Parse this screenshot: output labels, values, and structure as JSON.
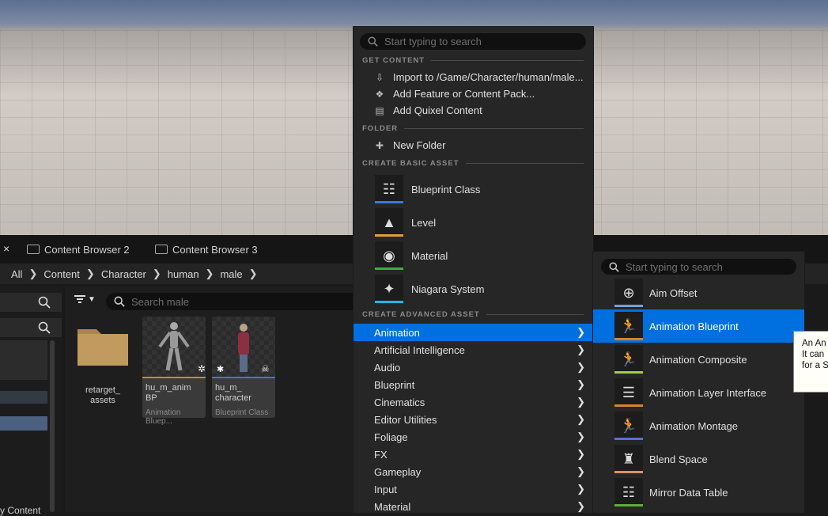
{
  "content_browser": {
    "close_glyph": "×",
    "tabs": [
      "Content Browser 2",
      "Content Browser 3"
    ],
    "breadcrumb": [
      "All",
      "Content",
      "Character",
      "human",
      "male"
    ],
    "search_placeholder": "Search male",
    "left_footer": "y Content",
    "assets": [
      {
        "name": "retarget_ assets",
        "type": "folder"
      },
      {
        "name": "hu_m_anim BP",
        "class": "Animation Bluep...",
        "accent": "#d9822b"
      },
      {
        "name": "hu_m_ character",
        "class": "Blueprint Class",
        "accent": "#3d78d8"
      }
    ]
  },
  "context_menu": {
    "search_placeholder": "Start typing to search",
    "sections": {
      "get_content": "GET CONTENT",
      "folder": "FOLDER",
      "create_basic": "CREATE BASIC ASSET",
      "create_advanced": "CREATE ADVANCED ASSET"
    },
    "get_content_items": [
      "Import to /Game/Character/human/male...",
      "Add Feature or Content Pack...",
      "Add Quixel Content"
    ],
    "folder_items": [
      "New Folder"
    ],
    "basic_assets": [
      {
        "label": "Blueprint Class",
        "accent": "#3d78d8"
      },
      {
        "label": "Level",
        "accent": "#e0a030"
      },
      {
        "label": "Material",
        "accent": "#3fae3f"
      },
      {
        "label": "Niagara System",
        "accent": "#21b6e0"
      }
    ],
    "advanced_categories": [
      "Animation",
      "Artificial Intelligence",
      "Audio",
      "Blueprint",
      "Cinematics",
      "Editor Utilities",
      "Foliage",
      "FX",
      "Gameplay",
      "Input",
      "Material"
    ],
    "active_category": "Animation"
  },
  "submenu": {
    "search_placeholder": "Start typing to search",
    "items": [
      {
        "label": "Aim Offset",
        "accent": "#7a9ed6"
      },
      {
        "label": "Animation Blueprint",
        "accent": "#d9822b"
      },
      {
        "label": "Animation Composite",
        "accent": "#a3c94a"
      },
      {
        "label": "Animation Layer Interface",
        "accent": "#d9822b"
      },
      {
        "label": "Animation Montage",
        "accent": "#5a6fd6"
      },
      {
        "label": "Blend Space",
        "accent": "#e08f6a"
      },
      {
        "label": "Mirror Data Table",
        "accent": "#5cae3c"
      }
    ],
    "active_item": "Animation Blueprint"
  },
  "tooltip": {
    "lines": [
      "An An",
      "It can ",
      "for a S"
    ]
  },
  "colors": {
    "accent_blue": "#0070e0",
    "menu_bg": "#262626"
  }
}
